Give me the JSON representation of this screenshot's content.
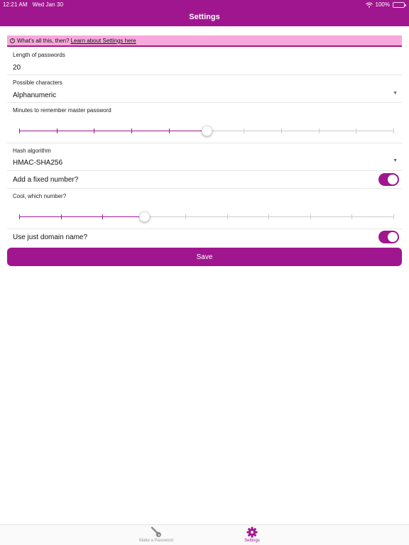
{
  "status_bar": {
    "time": "12:21 AM",
    "date": "Wed Jan 30",
    "battery": "100%",
    "battery_level": 1.0
  },
  "header": {
    "title": "Settings"
  },
  "info_banner": {
    "text": "What's all this, then?",
    "link": "Learn about Settings here"
  },
  "fields": {
    "length": {
      "label": "Length of passwords",
      "value": "20"
    },
    "characters": {
      "label": "Possible characters",
      "value": "Alphanumeric"
    },
    "minutes": {
      "label": "Minutes to remember master password",
      "ticks": 11,
      "position_fraction": 0.5
    },
    "hash": {
      "label": "Hash algorithm",
      "value": "HMAC-SHA256"
    },
    "fixed_number": {
      "label": "Add a fixed number?",
      "on": true
    },
    "which_number": {
      "label": "Cool, which number?",
      "ticks": 10,
      "position_fraction": 0.3333
    },
    "domain_only": {
      "label": "Use just domain name?",
      "on": true
    }
  },
  "save_label": "Save",
  "tabs": [
    {
      "label": "Make a Password",
      "icon": "key-icon",
      "active": false
    },
    {
      "label": "Settings",
      "icon": "gear-icon",
      "active": true
    }
  ],
  "colors": {
    "accent": "#a0168f",
    "banner": "#f8a8dc"
  }
}
